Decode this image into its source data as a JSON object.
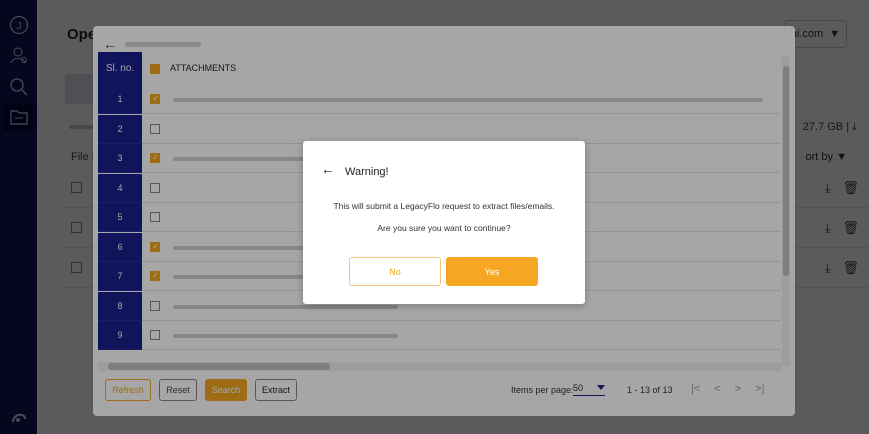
{
  "rail": {
    "icons": [
      "user-circle-icon",
      "user-settings-icon",
      "search-icon",
      "folder-icon",
      "brand-icon"
    ],
    "avatar_letter": "J"
  },
  "page": {
    "title": "Ope",
    "account": "hi.com",
    "storage": "27.7 GB |",
    "sort": "ort by",
    "file_header": "File N"
  },
  "extract": {
    "header": {
      "sl": "Sl. no.",
      "attachments": "ATTACHMENTS"
    },
    "rows": [
      {
        "num": "1",
        "checked": true
      },
      {
        "num": "2",
        "checked": false
      },
      {
        "num": "3",
        "checked": true
      },
      {
        "num": "4",
        "checked": false
      },
      {
        "num": "5",
        "checked": false
      },
      {
        "num": "6",
        "checked": true
      },
      {
        "num": "7",
        "checked": true
      },
      {
        "num": "8",
        "checked": false
      },
      {
        "num": "9",
        "checked": false
      }
    ],
    "footer": {
      "refresh": "Refresh",
      "reset": "Reset",
      "search": "Search",
      "extract": "Extract",
      "items_per_page_label": "Items per page:",
      "items_per_page": "50",
      "range": "1 - 13 of 13",
      "pager": [
        "|<",
        "<",
        ">",
        ">|"
      ]
    }
  },
  "modal": {
    "title": "Warning!",
    "message1": "This will submit a LegacyFlo request to extract files/emails.",
    "message2": "Are you sure you want to continue?",
    "no": "No",
    "yes": "Yes"
  },
  "colors": {
    "accent": "#f5a623",
    "navy": "#121659",
    "table_blue": "#1a1f8c"
  }
}
